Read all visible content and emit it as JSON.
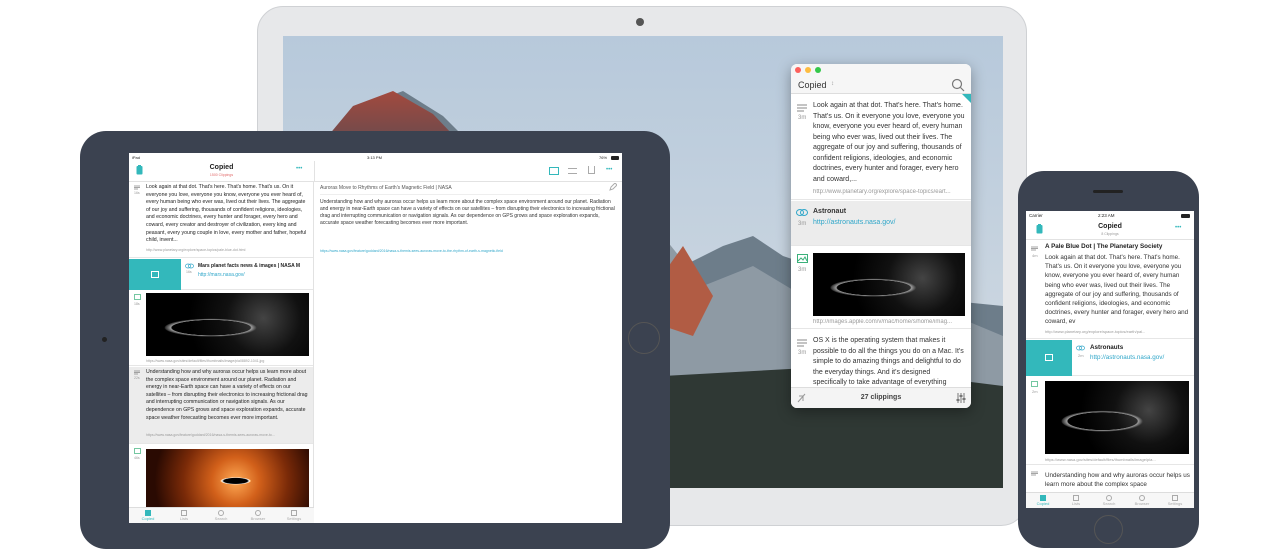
{
  "app": {
    "name": "Copied",
    "accent": "#33b8bb",
    "link_color": "#2fa6c9"
  },
  "mac": {
    "window_title": "Copied",
    "title_chevron": "↕",
    "search_icon": "search-icon",
    "clippings": [
      {
        "type": "text",
        "time": "3m",
        "text": "Look again at that dot. That's here. That's home. That's us. On it everyone you love, everyone you know, everyone you ever heard of, every human being who ever was, lived out their lives. The aggregate of our joy and suffering, thousands of confident religions, ideologies, and economic doctrines, every hunter and forager, every hero and coward,...",
        "url": "http://www.planetary.org/explore/space-topics/eart..."
      },
      {
        "type": "link",
        "time": "3m",
        "title": "Astronaut",
        "link": "http://astronauts.nasa.gov/"
      },
      {
        "type": "image",
        "time": "3m",
        "url": "http://images.apple.com/v/mac/home/s/home/imag..."
      },
      {
        "type": "text",
        "time": "3m",
        "text": "OS X is the operating system that makes it possible to do all the things you do on a Mac. It's simple to do amazing things and delightful to do the everyday things. And it's designed specifically to take advantage of everything"
      }
    ],
    "footer_count": "27 clippings"
  },
  "ipad": {
    "status_left": "iPad",
    "status_time": "3:13 PM",
    "status_right": "76%",
    "title": "Copied",
    "subtitle": "1500 Clippings",
    "more": "•••",
    "detail_title": "Auroras Move to Rhythms of Earth's Magnetic Field | NASA",
    "detail_text": "Understanding how and why auroras occur helps us learn more about the complex space environment around our planet. Radiation and energy in near-Earth space can have a variety of effects on our satellites – from disrupting their electronics to increasing frictional drag and interrupting communication or navigation signals. As our dependence on GPS grows and space exploration expands, accurate space weather forecasting becomes ever more important.",
    "detail_url": "https://www.nasa.gov/feature/goddard/2016/nasa-s-themis-sees-auroras-move-to-the-rhythm-of-earth-s-magnetic-field",
    "clippings": [
      {
        "time": "16s",
        "text": "Look again at that dot. That's here. That's home. That's us. On it everyone you love, everyone you know, everyone you ever heard of, every human being who ever was, lived out their lives. The aggregate of our joy and suffering, thousands of confident religions, ideologies, and economic doctrines, every hunter and forager, every hero and coward, every creator and destroyer of civilization, every king and peasant, every young couple in love, every mother and father, hopeful child, invent...",
        "url": "http://www.planetary.org/explore/space-topics/pale-blue-dot.html"
      },
      {
        "time": "16s",
        "title": "Mars planet facts news & images | NASA M",
        "link": "http://mars.nasa.gov/"
      },
      {
        "time": "18s",
        "url": "https://www.nasa.gov/sites/default/files/thumbnails/image/pia08892-1041.jpg"
      },
      {
        "time": "22s",
        "text": "Understanding how and why auroras occur helps us learn more about the complex space environment around our planet. Radiation and energy in near-Earth space can have a variety of effects on our satellites – from disrupting their electronics to increasing frictional drag and interrupting communication or navigation signals. As our dependence on GPS grows and space exploration expands, accurate space weather forecasting becomes ever more important.",
        "url": "https://www.nasa.gov/feature/goddard/2016/nasa-s-themis-sees-auroras-move-to..."
      },
      {
        "time": "46s"
      }
    ],
    "tabs": [
      "Copied",
      "Lists",
      "Search",
      "Browser",
      "Settings"
    ]
  },
  "iphone": {
    "status_left": "Carrier",
    "status_time": "2:23 AM",
    "title": "Copied",
    "subtitle": "8 Clippings",
    "more": "•••",
    "clippings": [
      {
        "time": "4m",
        "title": "A Pale Blue Dot | The Planetary Society",
        "text": "Look again at that dot. That's here. That's home. That's us. On it everyone you love, everyone you know, everyone you ever heard of, every human being who ever was, lived out their lives. The aggregate of our joy and suffering, thousands of confident religions, ideologies, and economic doctrines, every hunter and forager, every hero and coward, ev",
        "url": "http://www.planetary.org/explore/space-topics/earth/pal..."
      },
      {
        "time": "2m",
        "title": "Astronauts",
        "link": "http://astronauts.nasa.gov/"
      },
      {
        "time": "2m",
        "url": "https://www.nasa.gov/sites/default/files/thumbnails/image/pia..."
      },
      {
        "text": "Understanding how and why auroras occur helps us learn more about the complex space"
      }
    ],
    "tabs": [
      "Copied",
      "Lists",
      "Search",
      "Browser",
      "Settings"
    ]
  }
}
